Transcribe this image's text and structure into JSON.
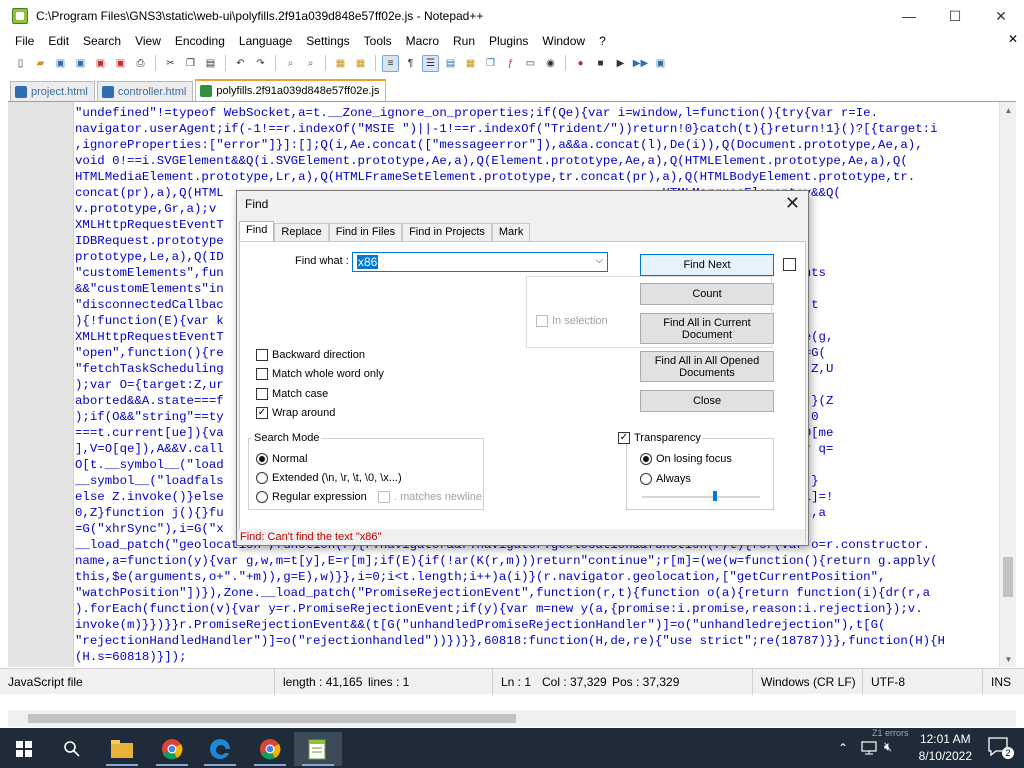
{
  "window": {
    "title": "C:\\Program Files\\GNS3\\static\\web-ui\\polyfills.2f91a039d848e57ff02e.js - Notepad++",
    "minimize": "—",
    "maximize": "☐",
    "close": "✕"
  },
  "menu": [
    "File",
    "Edit",
    "Search",
    "View",
    "Encoding",
    "Language",
    "Settings",
    "Tools",
    "Macro",
    "Run",
    "Plugins",
    "Window",
    "?"
  ],
  "menu_close": "✕",
  "tabs": [
    {
      "label": "project.html"
    },
    {
      "label": "controller.html"
    },
    {
      "label": "polyfills.2f91a039d848e57ff02e.js"
    }
  ],
  "code_lines": [
    "\"undefined\"!=typeof WebSocket,a=t.__Zone_ignore_on_properties;if(Qe){var i=window,l=function(){try{var r=Ie.",
    "navigator.userAgent;if(-1!==r.indexOf(\"MSIE \")||-1!==r.indexOf(\"Trident/\"))return!0}catch(t){}return!1}()?[{target:i",
    ",ignoreProperties:[\"error\"]}]:[];Q(i,Ae.concat([\"messageerror\"]),a&&a.concat(l),De(i)),Q(Document.prototype,Ae,a),",
    "void 0!==i.SVGElement&&Q(i.SVGElement.prototype,Ae,a),Q(Element.prototype,Ae,a),Q(HTMLElement.prototype,Ae,a),Q(",
    "HTMLMediaElement.prototype,Lr,a),Q(HTMLFrameSetElement.prototype,tr.concat(pr),a),Q(HTMLBodyElement.prototype,tr.",
    "concat(pr),a),Q(HTML                                                          .HTMLMarqueeElement;v&&Q(",
    "v.prototype,Gr,a);v                                                           type,yr,a);var E=t.",
    "XMLHttpRequestEventT                                                          x.prototype,Le,a),Q(",
    "IDBRequest.prototype                                                          Q(IDBTransaction.",
    "prototype,Le,a),Q(ID                                                          load_patch(",
    "\"customElements\",fun                                                          sMix)&&r.customElements",
    "&&\"customElements\"in                                                          ectedCallback\",",
    "\"disconnectedCallbac                                                          tch(\"XHR\",function(r,t",
    "){!function(E){var k                                                          ",
    "XMLHttpRequestEventT                                                          e\",f=\"scheduled\",W=be(g,",
    "\"open\",function(){re                                                          etchTaskAborting\"),L=G(",
    "\"fetchTaskScheduling                                                          Z[a])return le.apply(Z,U",
    ");var O={target:Z,ur                                                          ,Y);Z&&!0===Z[y]&&!O.",
    "aborted&&A.state===f                                                          nction(Z){return Z[o]}(Z",
    ");if(O&&\"string\"==ty                                                          ancelTask(O)else if(!0",
    "===t.current[ue]){va                                                          !1;var A=O[i];D||(D=O[me",
    "],V=O[qe]),A&&V.call                                                          [l]&&Z.state===f){var q=",
    "O[t.__symbol__(\"load                                                          n(){for(var d=O[t.",
    "__symbol__(\"loadfals                                                          &p.call(Z)),q.push(Z)}",
    "else Z.invoke()}else                                                          e.apply(O,U.args),O[l]=!",
    "0,Z}function j(){}fu                                                          r);var o=G(\"xhrTask\"),a",
    "=G(\"xhrSync\"),i=G(\"x                                                          led\")}),Zone.",
    "__load_patch(\"geolocation\",function(r){r.navigator&&r.navigator.geolocation&&function(r,t){for(var o=r.constructor.",
    "name,a=function(y){var g,w,m=t[y],E=r[m];if(E){if(!ar(K(r,m)))return\"continue\";r[m]=(we(w=function(){return g.apply(",
    "this,$e(arguments,o+\".\"+m)),g=E),w)}},i=0;i<t.length;i++)a(i)}(r.navigator.geolocation,[\"getCurrentPosition\",",
    "\"watchPosition\"])}),Zone.__load_patch(\"PromiseRejectionEvent\",function(r,t){function o(a){return function(i){dr(r,a",
    ").forEach(function(v){var y=r.PromiseRejectionEvent;if(y){var m=new y(a,{promise:i.promise,reason:i.rejection});v.",
    "invoke(m)}})}}r.PromiseRejectionEvent&&(t[G(\"unhandledPromiseRejectionHandler\")]=o(\"unhandledrejection\"),t[G(",
    "\"rejectionHandledHandler\")]=o(\"rejectionhandled\"))})}},60818:function(H,de,re){\"use strict\";re(18787)}},function(H){H",
    "(H.s=60818)}]);"
  ],
  "status": {
    "filetype": "JavaScript file",
    "length": "length : 41,165",
    "lines": "lines : 1",
    "ln": "Ln : 1",
    "col": "Col : 37,329",
    "pos": "Pos : 37,329",
    "eol": "Windows (CR LF)",
    "encoding": "UTF-8",
    "mode": "INS"
  },
  "taskbar": {
    "time": "12:01 AM",
    "date": "8/10/2022",
    "notif_count": "2",
    "tray_label": "Z1 errors"
  },
  "dialog": {
    "title": "Find",
    "tabs": [
      "Find",
      "Replace",
      "Find in Files",
      "Find in Projects",
      "Mark"
    ],
    "find_what_label": "Find what :",
    "find_what_value": "x86",
    "buttons": {
      "find_next": "Find Next",
      "count": "Count",
      "find_all_current": "Find All in Current Document",
      "find_all_opened": "Find All in All Opened Documents",
      "close": "Close"
    },
    "in_selection": "In selection",
    "options": {
      "backward": "Backward direction",
      "whole_word": "Match whole word only",
      "match_case": "Match case",
      "wrap_around": "Wrap around"
    },
    "search_mode": {
      "label": "Search Mode",
      "normal": "Normal",
      "extended": "Extended (\\n, \\r, \\t, \\0, \\x...)",
      "regex": "Regular expression",
      "matches_newline": ". matches newline"
    },
    "transparency": {
      "label": "Transparency",
      "on_losing_focus": "On losing focus",
      "always": "Always",
      "level": 0.6
    },
    "status_message": "Find: Can't find the text \"x86\""
  }
}
